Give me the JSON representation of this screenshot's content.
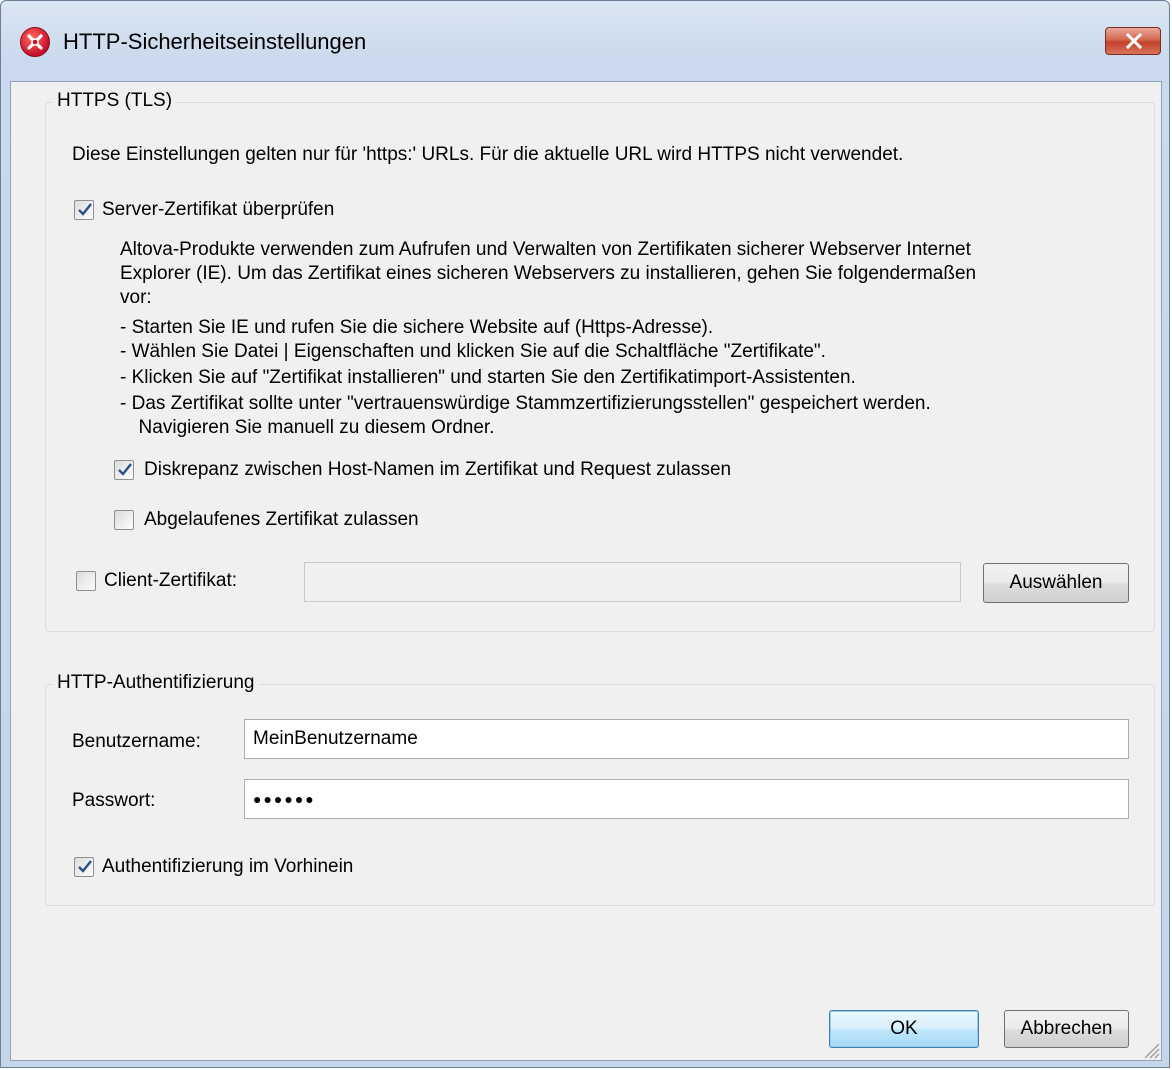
{
  "window": {
    "title": "HTTP-Sicherheitseinstellungen"
  },
  "https_group": {
    "legend": "HTTPS (TLS)",
    "info": "Diese Einstellungen gelten nur für 'https:' URLs. Für die aktuelle URL wird HTTPS nicht verwendet.",
    "verify_server_cert": {
      "label": "Server-Zertifikat überprüfen",
      "checked": true
    },
    "description_lines": [
      "Altova-Produkte verwenden zum Aufrufen und Verwalten von Zertifikaten sicherer Webserver Internet",
      "Explorer (IE). Um das Zertifikat eines sicheren Webservers zu installieren, gehen Sie folgendermaßen",
      "vor:",
      "- Starten Sie IE und rufen Sie die sichere Website auf (Https-Adresse).",
      "- Wählen Sie Datei | Eigenschaften und klicken Sie auf die Schaltfläche \"Zertifikate\".",
      "- Klicken Sie auf \"Zertifikat installieren\" und starten Sie den Zertifikatimport-Assistenten.",
      "- Das Zertifikat sollte unter \"vertrauenswürdige Stammzertifizierungsstellen\" gespeichert werden.",
      "  Navigieren Sie manuell zu diesem Ordner."
    ],
    "host_mismatch": {
      "label": "Diskrepanz zwischen Host-Namen im Zertifikat und Request zulassen",
      "checked": true
    },
    "expired_cert": {
      "label": "Abgelaufenes Zertifikat zulassen",
      "checked": false
    },
    "client_cert": {
      "label": "Client-Zertifikat:",
      "checked": false,
      "value": "",
      "select_label": "Auswählen"
    }
  },
  "auth_group": {
    "legend": "HTTP-Authentifizierung",
    "username_label": "Benutzername:",
    "username_value": "MeinBenutzername",
    "password_label": "Passwort:",
    "password_value": "●●●●●●",
    "preemptive": {
      "label": "Authentifizierung im Vorhinein",
      "checked": true
    }
  },
  "buttons": {
    "ok": "OK",
    "cancel": "Abbrechen"
  },
  "colors": {
    "accent_close": "#c4412b",
    "check_mark": "#2a4f86"
  }
}
